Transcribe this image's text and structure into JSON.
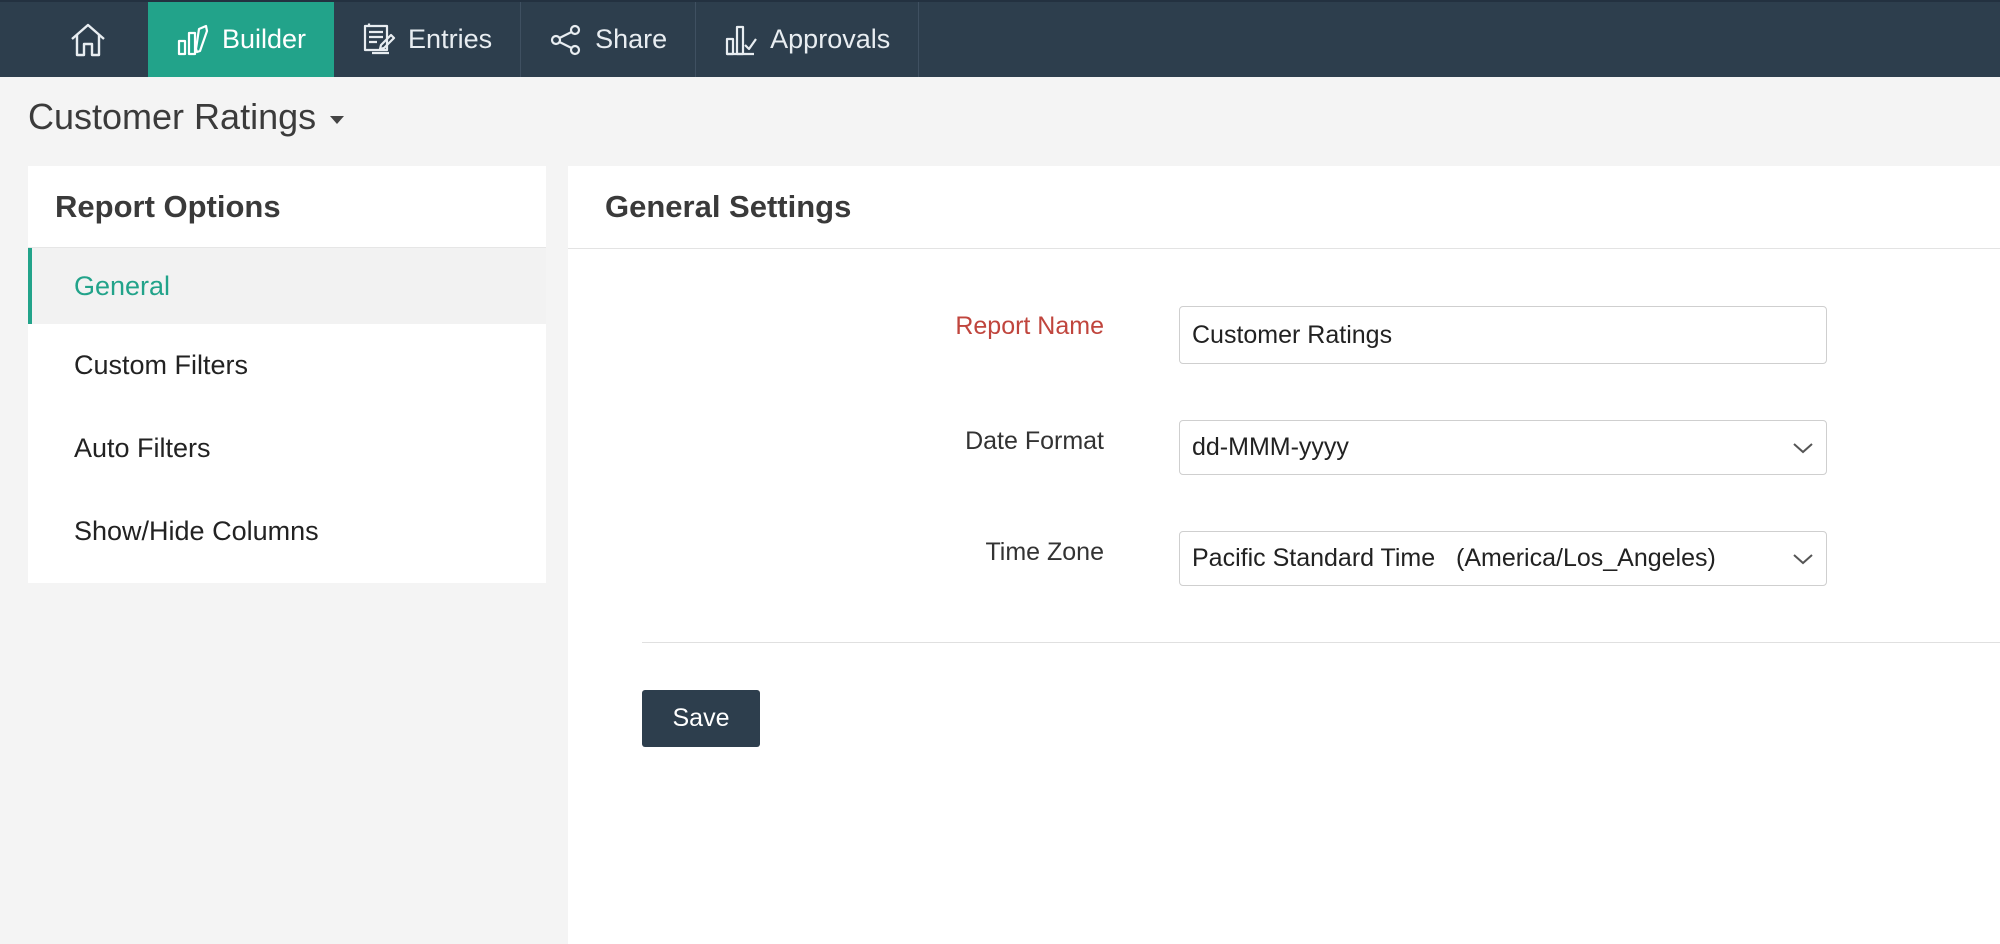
{
  "nav": {
    "home_icon": "home-icon",
    "items": [
      {
        "label": "Builder",
        "icon": "builder-icon",
        "active": true
      },
      {
        "label": "Entries",
        "icon": "entries-icon",
        "active": false
      },
      {
        "label": "Share",
        "icon": "share-icon",
        "active": false
      },
      {
        "label": "Approvals",
        "icon": "approvals-icon",
        "active": false
      }
    ]
  },
  "report": {
    "title": "Customer Ratings"
  },
  "options": {
    "header": "Report Options",
    "items": [
      {
        "label": "General",
        "active": true
      },
      {
        "label": "Custom Filters",
        "active": false
      },
      {
        "label": "Auto Filters",
        "active": false
      },
      {
        "label": "Show/Hide Columns",
        "active": false
      }
    ]
  },
  "settings": {
    "header": "General Settings",
    "report_name": {
      "label": "Report Name",
      "value": "Customer Ratings",
      "required": true
    },
    "date_format": {
      "label": "Date Format",
      "value": "dd-MMM-yyyy"
    },
    "time_zone": {
      "label": "Time Zone",
      "value": "Pacific Standard Time   (America/Los_Angeles)"
    },
    "save_label": "Save"
  },
  "colors": {
    "accent": "#22a38a",
    "nav_bg": "#2d3e4d",
    "required": "#c0453d"
  }
}
